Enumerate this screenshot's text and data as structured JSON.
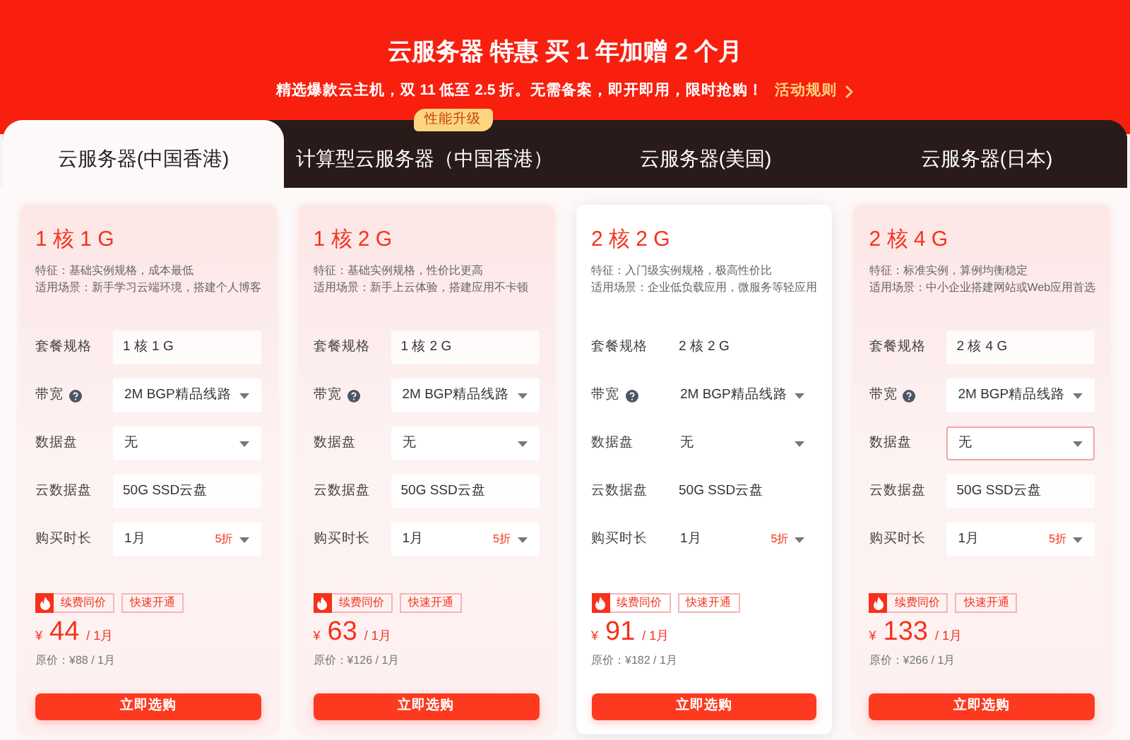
{
  "banner": {
    "title": "云服务器 特惠 买 1 年加赠 2 个月",
    "subtitle": "精选爆款云主机，双 11 低至 2.5 折。无需备案，即开即用，限时抢购！",
    "rules_link": "活动规则"
  },
  "tabs": [
    {
      "label": "云服务器(中国香港)",
      "selected": true
    },
    {
      "label": "计算型云服务器（中国香港）",
      "selected": false,
      "badge": "性能升级"
    },
    {
      "label": "云服务器(美国)",
      "selected": false
    },
    {
      "label": "云服务器(日本)",
      "selected": false
    }
  ],
  "plans": [
    {
      "name": "1 核 1 G",
      "feature": "特征：基础实例规格，成本最低",
      "scenario": "适用场景：新手学习云端环境，搭建个人博客",
      "hovered": false,
      "fields": [
        {
          "label": "套餐规格",
          "kind": "text",
          "value": "1 核 1 G"
        },
        {
          "label": "带宽",
          "kind": "select",
          "help": true,
          "value": "2M BGP精品线路"
        },
        {
          "label": "数据盘",
          "kind": "select",
          "value": "无",
          "focused": false
        },
        {
          "label": "云数据盘",
          "kind": "text",
          "value": "50G SSD云盘"
        },
        {
          "label": "购买时长",
          "kind": "select",
          "value": "1月",
          "discount": "5折"
        }
      ],
      "tags": [
        "续费同价",
        "快速开通"
      ],
      "currency": "¥",
      "price": "44",
      "unit": "/ 1月",
      "original": "原价：¥88 / 1月",
      "button": "立即选购"
    },
    {
      "name": "1 核 2 G",
      "feature": "特征：基础实例规格，性价比更高",
      "scenario": "适用场景：新手上云体验，搭建应用不卡顿",
      "hovered": false,
      "fields": [
        {
          "label": "套餐规格",
          "kind": "text",
          "value": "1 核 2 G"
        },
        {
          "label": "带宽",
          "kind": "select",
          "help": true,
          "value": "2M BGP精品线路"
        },
        {
          "label": "数据盘",
          "kind": "select",
          "value": "无",
          "focused": false
        },
        {
          "label": "云数据盘",
          "kind": "text",
          "value": "50G SSD云盘"
        },
        {
          "label": "购买时长",
          "kind": "select",
          "value": "1月",
          "discount": "5折"
        }
      ],
      "tags": [
        "续费同价",
        "快速开通"
      ],
      "currency": "¥",
      "price": "63",
      "unit": "/ 1月",
      "original": "原价：¥126 / 1月",
      "button": "立即选购"
    },
    {
      "name": "2 核 2 G",
      "feature": "特征：入门级实例规格，极高性价比",
      "scenario": "适用场景：企业低负载应用，微服务等轻应用",
      "hovered": true,
      "fields": [
        {
          "label": "套餐规格",
          "kind": "text",
          "value": "2 核 2 G"
        },
        {
          "label": "带宽",
          "kind": "select",
          "help": true,
          "value": "2M BGP精品线路"
        },
        {
          "label": "数据盘",
          "kind": "select",
          "value": "无",
          "focused": false
        },
        {
          "label": "云数据盘",
          "kind": "text",
          "value": "50G SSD云盘"
        },
        {
          "label": "购买时长",
          "kind": "select",
          "value": "1月",
          "discount": "5折"
        }
      ],
      "tags": [
        "续费同价",
        "快速开通"
      ],
      "currency": "¥",
      "price": "91",
      "unit": "/ 1月",
      "original": "原价：¥182 / 1月",
      "button": "立即选购"
    },
    {
      "name": "2 核 4 G",
      "feature": "特征：标准实例，算例均衡稳定",
      "scenario": "适用场景：中小企业搭建网站或Web应用首选",
      "hovered": false,
      "fields": [
        {
          "label": "套餐规格",
          "kind": "text",
          "value": "2 核 4 G"
        },
        {
          "label": "带宽",
          "kind": "select",
          "help": true,
          "value": "2M BGP精品线路"
        },
        {
          "label": "数据盘",
          "kind": "select",
          "value": "无",
          "focused": true
        },
        {
          "label": "云数据盘",
          "kind": "text",
          "value": "50G SSD云盘"
        },
        {
          "label": "购买时长",
          "kind": "select",
          "value": "1月",
          "discount": "5折"
        }
      ],
      "tags": [
        "续费同价",
        "快速开通"
      ],
      "currency": "¥",
      "price": "133",
      "unit": "/ 1月",
      "original": "原价：¥266 / 1月",
      "button": "立即选购"
    }
  ]
}
